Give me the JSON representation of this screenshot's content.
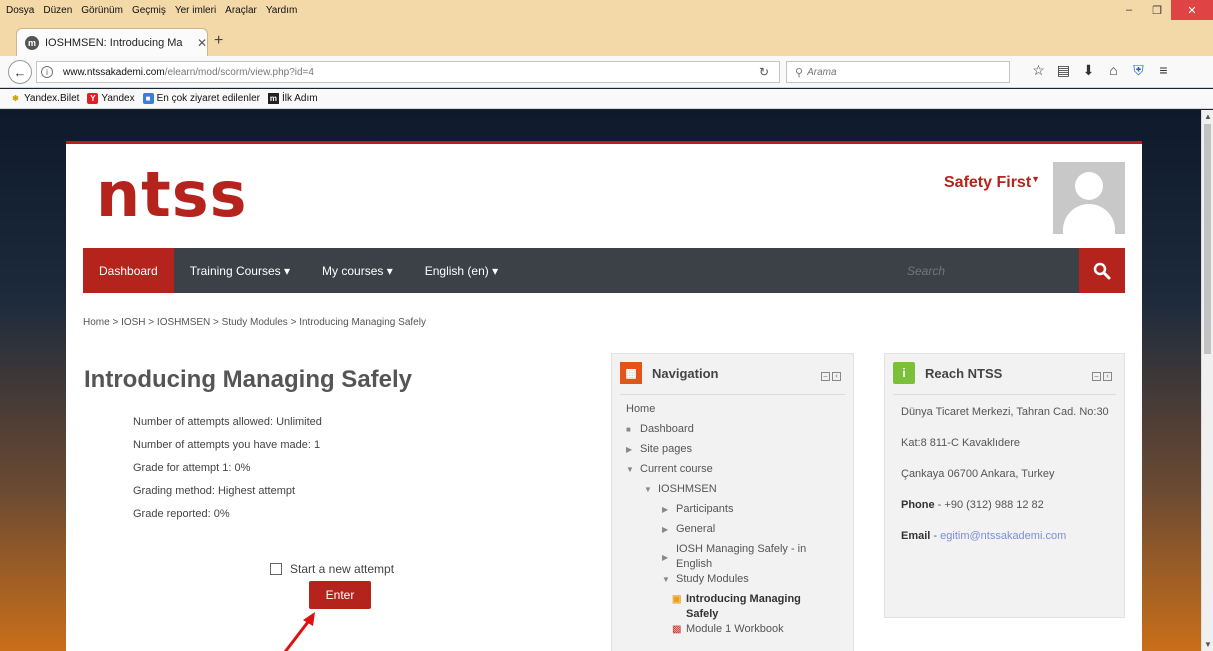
{
  "browser": {
    "menu": [
      "Dosya",
      "Düzen",
      "Görünüm",
      "Geçmiş",
      "Yer imleri",
      "Araçlar",
      "Yardım"
    ],
    "tab_title": "IOSHMSEN: Introducing Ma",
    "url_domain": "www.ntssakademi.com",
    "url_path": "/elearn/mod/scorm/view.php?id=4",
    "search_placeholder": "Arama",
    "bookmarks": [
      "Yandex.Bilet",
      "Yandex",
      "En çok ziyaret edilenler",
      "İlk Adım"
    ]
  },
  "site": {
    "logo": "ntss",
    "user_label": "Safety First",
    "nav": [
      "Dashboard",
      "Training Courses ▾",
      "My courses ▾",
      "English (en) ▾"
    ],
    "search_placeholder": "Search",
    "breadcrumb": "Home > IOSH > IOSHMSEN > Study Modules > Introducing Managing Safely"
  },
  "main": {
    "title": "Introducing Managing Safely",
    "info": [
      "Number of attempts allowed: Unlimited",
      "Number of attempts you have made: 1",
      "Grade for attempt 1: 0%",
      "Grading method: Highest attempt",
      "Grade reported: 0%"
    ],
    "new_attempt_label": "Start a new attempt",
    "enter_label": "Enter"
  },
  "navigation_block": {
    "title": "Navigation",
    "items": [
      "Home",
      "Dashboard",
      "Site pages",
      "Current course",
      "IOSHMSEN",
      "Participants",
      "General",
      "IOSH Managing Safely - in English",
      "Study Modules",
      "Introducing Managing Safely",
      "Module 1 Workbook"
    ]
  },
  "reach_block": {
    "title": "Reach NTSS",
    "address1": "Dünya Ticaret Merkezi, Tahran Cad. No:30",
    "address2": "Kat:8 811-C Kavaklıdere",
    "address3": "Çankaya 06700 Ankara, Turkey",
    "phone_label": "Phone",
    "phone": " - +90 (312) 988 12 82",
    "email_label": "Email",
    "email": "egitim@ntssakademi.com"
  },
  "colors": {
    "brand": "#b5231d",
    "nav_bg": "#3c4147",
    "block_bg": "#f2f2f2"
  }
}
